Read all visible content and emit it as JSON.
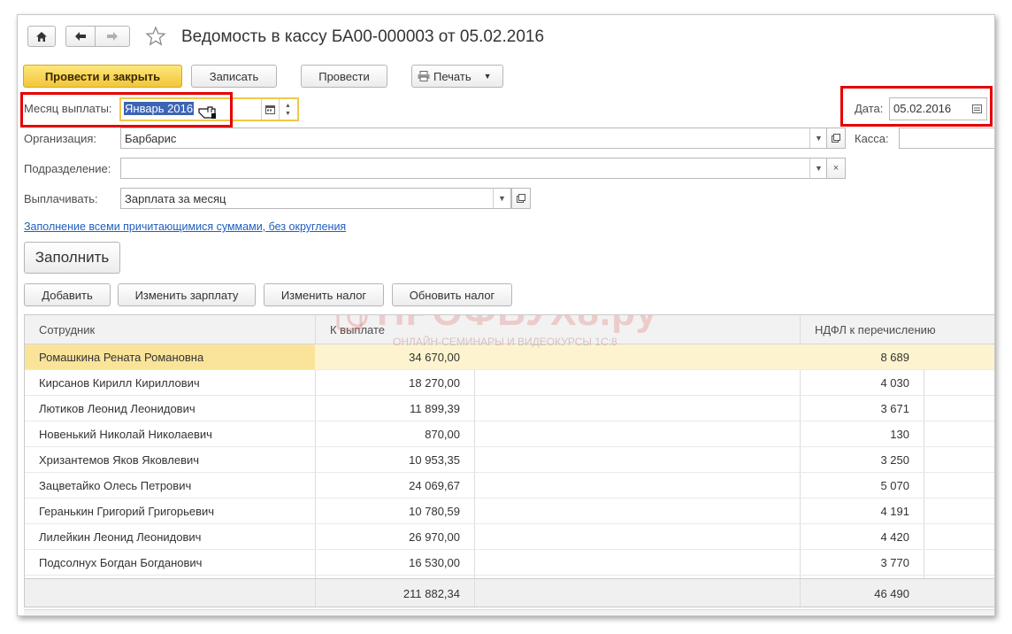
{
  "window": {
    "title": "Ведомость в кассу БА00-000003 от 05.02.2016"
  },
  "icons": {
    "home": "home-icon",
    "back": "arrow-left-icon",
    "forward": "arrow-right-icon",
    "star": "star-icon",
    "printer": "printer-icon",
    "calendar": "calendar-icon",
    "dropdown": "chevron-down-icon",
    "open": "open-form-icon",
    "clear": "close-icon",
    "cursor": "hand-pointer-icon"
  },
  "toolbar": {
    "post_close": "Провести и закрыть",
    "save": "Записать",
    "post": "Провести",
    "print": "Печать"
  },
  "form": {
    "month_label": "Месяц выплаты:",
    "month_value": "Январь 2016",
    "date_label": "Дата:",
    "date_value": "05.02.2016",
    "org_label": "Организация:",
    "org_value": "Барбарис",
    "kassa_label": "Касса:",
    "kassa_value": "",
    "dept_label": "Подразделение:",
    "dept_value": "",
    "pay_label": "Выплачивать:",
    "pay_value": "Зарплата за месяц",
    "fill_link": "Заполнение всеми причитающимися суммами, без округления",
    "fill_button": "Заполнить"
  },
  "table_toolbar": {
    "add": "Добавить",
    "change_salary": "Изменить зарплату",
    "change_tax": "Изменить налог",
    "update_tax": "Обновить налог"
  },
  "table": {
    "columns": [
      "Сотрудник",
      "К выплате",
      "НДФЛ к перечислению"
    ],
    "rows": [
      {
        "name": "Ромашкина Рената Романовна",
        "pay": "34 670,00",
        "tax": "8 689"
      },
      {
        "name": "Кирсанов Кирилл Кириллович",
        "pay": "18 270,00",
        "tax": "4 030"
      },
      {
        "name": "Лютиков Леонид Леонидович",
        "pay": "11 899,39",
        "tax": "3 671"
      },
      {
        "name": "Новенький Николай Николаевич",
        "pay": "870,00",
        "tax": "130"
      },
      {
        "name": "Хризантемов Яков Яковлевич",
        "pay": "10 953,35",
        "tax": "3 250"
      },
      {
        "name": "Зацветайко Олесь Петрович",
        "pay": "24 069,67",
        "tax": "5 070"
      },
      {
        "name": "Геранькин Григорий Григорьевич",
        "pay": "10 780,59",
        "tax": "4 191"
      },
      {
        "name": "Лилейкин Леонид Леонидович",
        "pay": "26 970,00",
        "tax": "4 420"
      },
      {
        "name": "Подсолнух Богдан Богданович",
        "pay": "16 530,00",
        "tax": "3 770"
      }
    ],
    "selected_row": 0,
    "total_pay": "211 882,34",
    "total_tax": "46 490"
  },
  "watermark": {
    "brand": "ПРОФБУХ8.ру",
    "tagline": "ОНЛАЙН-СЕМИНАРЫ И ВИДЕОКУРСЫ 1С:8"
  },
  "colors": {
    "primary_button": "#f3c53a",
    "highlight_box": "#e50000",
    "selected_row": "#fdf4cf",
    "link": "#1f5fbf"
  }
}
